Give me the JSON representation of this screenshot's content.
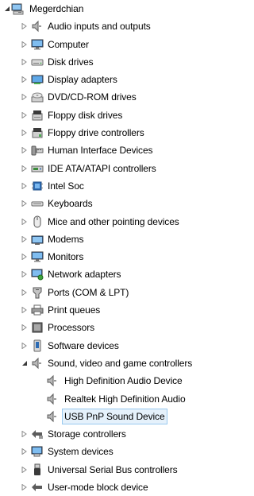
{
  "tree": {
    "root": {
      "label": "Megerdchian",
      "icon": "computer-icon",
      "expanded": true
    },
    "categories": [
      {
        "label": "Audio inputs and outputs",
        "icon": "speaker-icon",
        "expanded": false
      },
      {
        "label": "Computer",
        "icon": "monitor-icon",
        "expanded": false
      },
      {
        "label": "Disk drives",
        "icon": "disk-drive-icon",
        "expanded": false
      },
      {
        "label": "Display adapters",
        "icon": "display-adapter-icon",
        "expanded": false
      },
      {
        "label": "DVD/CD-ROM drives",
        "icon": "optical-drive-icon",
        "expanded": false
      },
      {
        "label": "Floppy disk drives",
        "icon": "floppy-disk-icon",
        "expanded": false
      },
      {
        "label": "Floppy drive controllers",
        "icon": "floppy-controller-icon",
        "expanded": false
      },
      {
        "label": "Human Interface Devices",
        "icon": "hid-icon",
        "expanded": false
      },
      {
        "label": "IDE ATA/ATAPI controllers",
        "icon": "ide-controller-icon",
        "expanded": false
      },
      {
        "label": "Intel Soc",
        "icon": "chip-icon",
        "expanded": false
      },
      {
        "label": "Keyboards",
        "icon": "keyboard-icon",
        "expanded": false
      },
      {
        "label": "Mice and other pointing devices",
        "icon": "mouse-icon",
        "expanded": false
      },
      {
        "label": "Modems",
        "icon": "modem-icon",
        "expanded": false
      },
      {
        "label": "Monitors",
        "icon": "monitor-icon",
        "expanded": false
      },
      {
        "label": "Network adapters",
        "icon": "network-adapter-icon",
        "expanded": false
      },
      {
        "label": "Ports (COM & LPT)",
        "icon": "port-icon",
        "expanded": false
      },
      {
        "label": "Print queues",
        "icon": "printer-icon",
        "expanded": false
      },
      {
        "label": "Processors",
        "icon": "processor-icon",
        "expanded": false
      },
      {
        "label": "Software devices",
        "icon": "software-device-icon",
        "expanded": false
      },
      {
        "label": "Sound, video and game controllers",
        "icon": "speaker-icon",
        "expanded": true,
        "children": [
          {
            "label": "High Definition Audio Device",
            "icon": "speaker-icon",
            "selected": false
          },
          {
            "label": "Realtek High Definition Audio",
            "icon": "speaker-icon",
            "selected": false
          },
          {
            "label": "USB PnP Sound Device",
            "icon": "speaker-icon",
            "selected": true
          }
        ]
      },
      {
        "label": "Storage controllers",
        "icon": "storage-controller-icon",
        "expanded": false
      },
      {
        "label": "System devices",
        "icon": "system-device-icon",
        "expanded": false
      },
      {
        "label": "Universal Serial Bus controllers",
        "icon": "usb-icon",
        "expanded": false
      },
      {
        "label": "User-mode block device",
        "icon": "block-device-icon",
        "expanded": false
      }
    ]
  }
}
